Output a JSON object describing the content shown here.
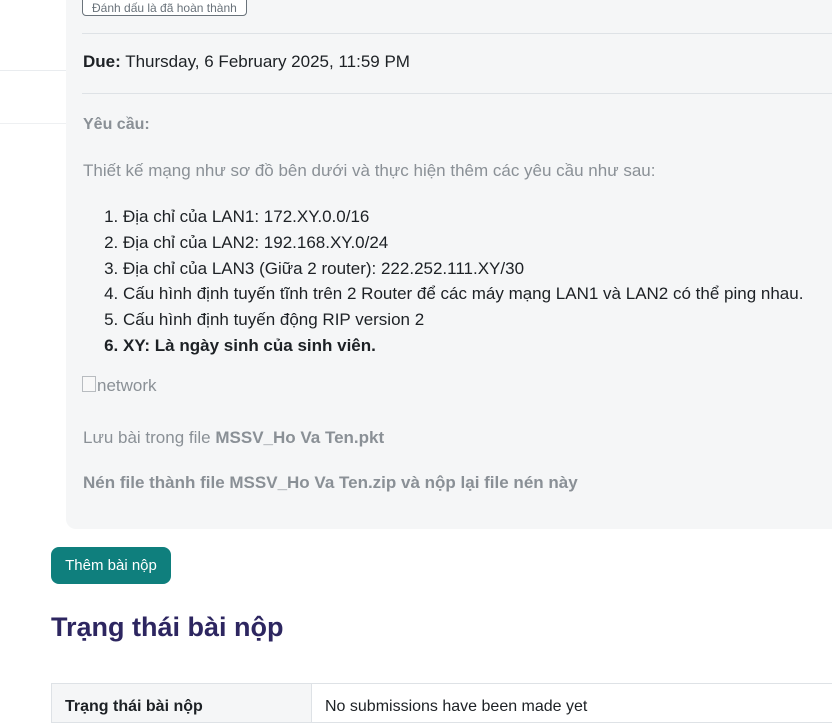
{
  "activity": {
    "mark_done_label": "Đánh dấu là đã hoàn thành",
    "due_label": "Due:",
    "due_value": "Thursday, 6 February 2025, 11:59 PM"
  },
  "description": {
    "requirements_title": "Yêu cầu:",
    "intro": "Thiết kế mạng như sơ đồ bên dưới và thực hiện thêm các yêu cầu như sau:",
    "items": [
      "Địa chỉ của LAN1: 172.XY.0.0/16",
      "Địa chỉ của LAN2: 192.168.XY.0/24",
      "Địa chỉ của LAN3 (Giữa 2 router): 222.252.111.XY/30",
      "Cấu hình định tuyến tĩnh trên 2 Router để các máy mạng LAN1 và LAN2 có thể ping nhau.",
      "Cấu hình định tuyến động RIP version 2",
      "XY: Là ngày sinh của sinh viên."
    ],
    "image_alt": "network",
    "save_prefix": "Lưu bài trong file ",
    "save_file": "MSSV_Ho Va Ten.pkt",
    "zip_instruction": "Nén file  thành file MSSV_Ho Va Ten.zip và nộp lại file nén này"
  },
  "submission": {
    "add_button_label": "Thêm bài nộp",
    "status_heading": "Trạng thái bài nộp",
    "table": {
      "header": "Trạng thái bài nộp",
      "value": "No submissions have been made yet"
    }
  },
  "colors": {
    "primary_button": "#0f7f7d",
    "heading": "#2d2660",
    "muted_text": "#8a9096"
  }
}
